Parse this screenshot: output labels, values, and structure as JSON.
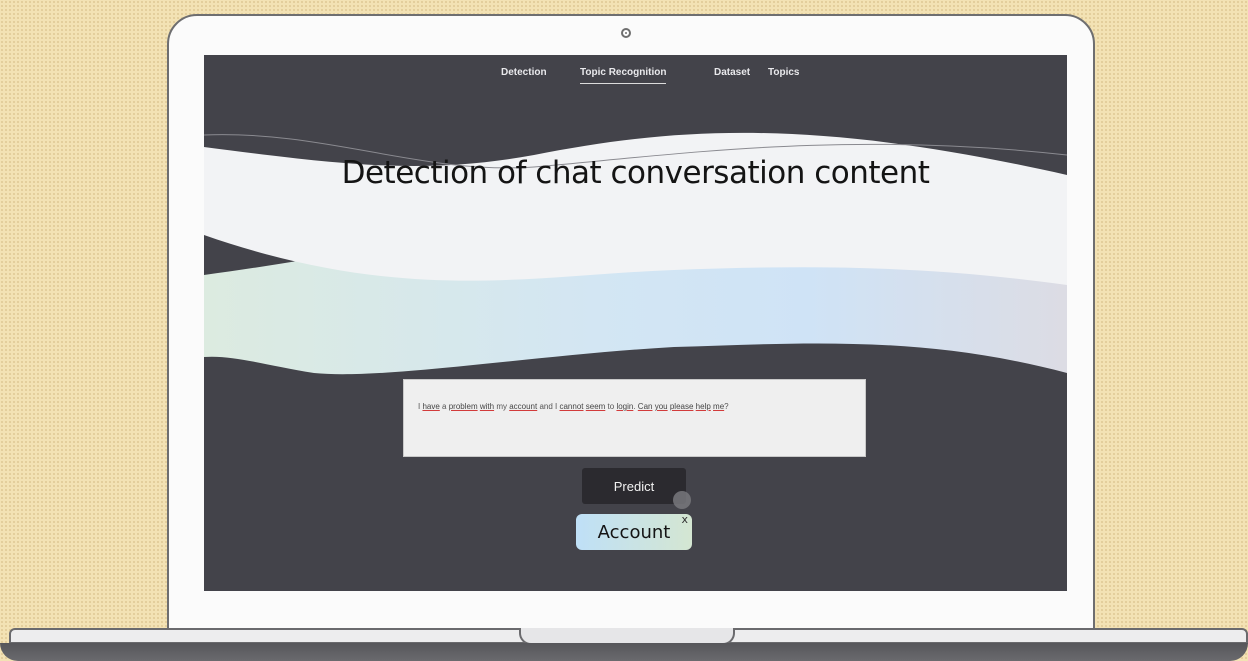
{
  "nav": {
    "items": [
      {
        "label": "Detection",
        "active": false
      },
      {
        "label": "Topic Recognition",
        "active": true
      },
      {
        "label": "Dataset",
        "active": false
      },
      {
        "label": "Topics",
        "active": false
      }
    ]
  },
  "hero": {
    "title": "Detection of chat conversation content"
  },
  "input": {
    "segments": [
      {
        "text": "I ",
        "u": false
      },
      {
        "text": "have",
        "u": true
      },
      {
        "text": " a ",
        "u": false
      },
      {
        "text": "problem",
        "u": true
      },
      {
        "text": " ",
        "u": false
      },
      {
        "text": "with",
        "u": true
      },
      {
        "text": " my ",
        "u": false
      },
      {
        "text": "account",
        "u": true
      },
      {
        "text": " and I ",
        "u": false
      },
      {
        "text": "cannot",
        "u": true
      },
      {
        "text": " ",
        "u": false
      },
      {
        "text": "seem",
        "u": true
      },
      {
        "text": " to ",
        "u": false
      },
      {
        "text": "login",
        "u": true
      },
      {
        "text": ". ",
        "u": false
      },
      {
        "text": "Can",
        "u": true
      },
      {
        "text": " ",
        "u": false
      },
      {
        "text": "you",
        "u": true
      },
      {
        "text": " ",
        "u": false
      },
      {
        "text": "please",
        "u": true
      },
      {
        "text": " ",
        "u": false
      },
      {
        "text": "help",
        "u": true
      },
      {
        "text": " ",
        "u": false
      },
      {
        "text": "me",
        "u": true
      },
      {
        "text": "?",
        "u": false
      }
    ]
  },
  "predict_button": {
    "label": "Predict"
  },
  "result": {
    "label": "Account",
    "close": "x"
  },
  "colors": {
    "screen_bg": "#43434a",
    "wave_light": "#f2f3f5",
    "wave_blue": "#cfe4f5",
    "wave_green": "#dcebe0",
    "button_bg": "#2b2a2f"
  }
}
